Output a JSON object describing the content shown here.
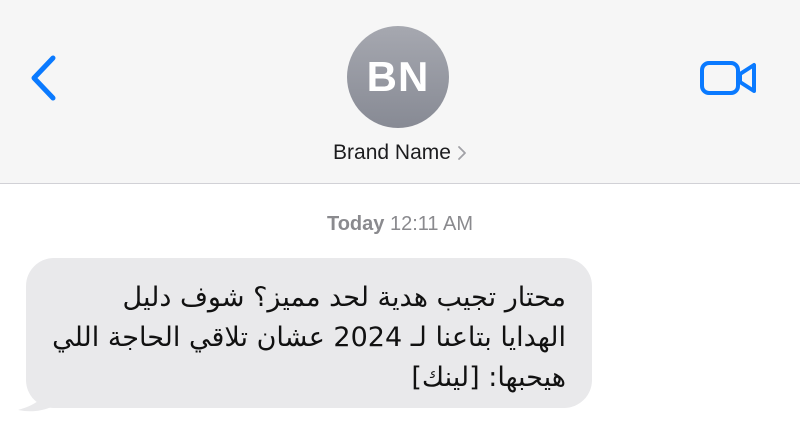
{
  "header": {
    "back_icon": "chevron-left-icon",
    "video_icon": "video-camera-icon",
    "accent_color": "#0a7aff",
    "avatar_initials": "BN",
    "contact_name": "Brand Name",
    "contact_chevron_icon": "chevron-right-icon"
  },
  "thread": {
    "timestamp_day": "Today",
    "timestamp_time": "12:11 AM",
    "messages": [
      {
        "direction": "incoming",
        "bubble_color": "#e9e9eb",
        "text": "محتار تجيب هدية لحد مميز؟ شوف دليل الهدايا بتاعنا لـ 2024 عشان تلاقي الحاجة اللي هيحبها: [لينك]"
      }
    ]
  }
}
